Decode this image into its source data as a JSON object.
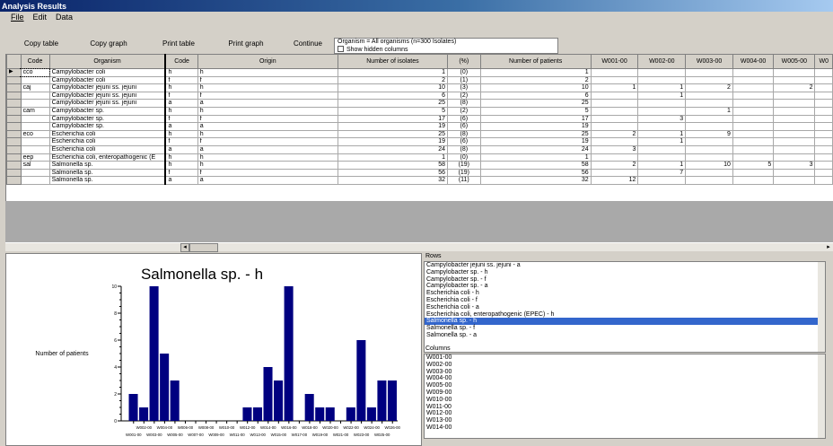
{
  "window": {
    "title": "Analysis Results"
  },
  "menu": [
    "File",
    "Edit",
    "Data"
  ],
  "toolbar": {
    "copy_table": "Copy table",
    "copy_graph": "Copy graph",
    "print_table": "Print table",
    "print_graph": "Print graph",
    "continue": "Continue",
    "organism_info": "Organism = All organisms  (n=300 Isolates)",
    "show_hidden": "Show hidden columns"
  },
  "grid": {
    "columns": [
      "Code",
      "Organism",
      "Code",
      "Origin",
      "Number of isolates",
      "(%)",
      "Number of patients",
      "W001-00",
      "W002-00",
      "W003-00",
      "W004-00",
      "W005-00",
      "W0"
    ],
    "rows": [
      [
        "cco",
        "Campylobacter coli",
        "h",
        "h",
        "1",
        "(0)",
        "1",
        "",
        "",
        "",
        "",
        "",
        ""
      ],
      [
        "",
        "Campylobacter coli",
        "f",
        "f",
        "2",
        "(1)",
        "2",
        "",
        "",
        "",
        "",
        "",
        ""
      ],
      [
        "caj",
        "Campylobacter jejuni ss. jejuni",
        "h",
        "h",
        "10",
        "(3)",
        "10",
        "1",
        "1",
        "2",
        "",
        "2",
        ""
      ],
      [
        "",
        "Campylobacter jejuni ss. jejuni",
        "f",
        "f",
        "6",
        "(2)",
        "6",
        "",
        "1",
        "",
        "",
        "",
        ""
      ],
      [
        "",
        "Campylobacter jejuni ss. jejuni",
        "a",
        "a",
        "25",
        "(8)",
        "25",
        "",
        "",
        "",
        "",
        "",
        ""
      ],
      [
        "cam",
        "Campylobacter sp.",
        "h",
        "h",
        "5",
        "(2)",
        "5",
        "",
        "",
        "1",
        "",
        "",
        ""
      ],
      [
        "",
        "Campylobacter sp.",
        "f",
        "f",
        "17",
        "(6)",
        "17",
        "",
        "3",
        "",
        "",
        "",
        ""
      ],
      [
        "",
        "Campylobacter sp.",
        "a",
        "a",
        "19",
        "(6)",
        "19",
        "",
        "",
        "",
        "",
        "",
        ""
      ],
      [
        "eco",
        "Escherichia coli",
        "h",
        "h",
        "25",
        "(8)",
        "25",
        "2",
        "1",
        "9",
        "",
        "",
        ""
      ],
      [
        "",
        "Escherichia coli",
        "f",
        "f",
        "19",
        "(6)",
        "19",
        "",
        "1",
        "",
        "",
        "",
        ""
      ],
      [
        "",
        "Escherichia coli",
        "a",
        "a",
        "24",
        "(8)",
        "24",
        "3",
        "",
        "",
        "",
        "",
        ""
      ],
      [
        "eep",
        "Escherichia coli, enteropathogenic (E",
        "h",
        "h",
        "1",
        "(0)",
        "1",
        "",
        "",
        "",
        "",
        "",
        ""
      ],
      [
        "sal",
        "Salmonella sp.",
        "h",
        "h",
        "58",
        "(19)",
        "58",
        "2",
        "1",
        "10",
        "5",
        "3",
        ""
      ],
      [
        "",
        "Salmonella sp.",
        "f",
        "f",
        "56",
        "(19)",
        "56",
        "",
        "7",
        "",
        "",
        "",
        ""
      ],
      [
        "",
        "Salmonella sp.",
        "a",
        "a",
        "32",
        "(11)",
        "32",
        "12",
        "",
        "",
        "",
        "",
        ""
      ]
    ]
  },
  "chart_data": {
    "type": "bar",
    "title": "Salmonella sp. - h",
    "ylabel": "Number of patients",
    "xlabel": "",
    "ylim": [
      0,
      10
    ],
    "yticks": [
      0,
      2,
      4,
      6,
      8,
      10
    ],
    "categories": [
      "W001-00",
      "W002-00",
      "W003-00",
      "W004-00",
      "W005-00",
      "W006-00",
      "W007-00",
      "W008-00",
      "W009-00",
      "W010-00",
      "W011-00",
      "W012-00",
      "W013-00",
      "W014-00",
      "W015-00",
      "W016-00",
      "W017-00",
      "W018-00",
      "W019-00",
      "W020-00",
      "W021-00",
      "W022-00",
      "W023-00",
      "W024-00",
      "W025-00",
      "W026-00"
    ],
    "values": [
      2,
      1,
      10,
      5,
      3,
      0,
      0,
      0,
      0,
      0,
      0,
      1,
      1,
      4,
      3,
      10,
      0,
      2,
      1,
      1,
      0,
      1,
      6,
      1,
      3,
      3
    ],
    "color": "#000080"
  },
  "panels": {
    "rows_label": "Rows",
    "columns_label": "Columns",
    "rows": [
      "Campylobacter jejuni ss. jejuni - a",
      "Campylobacter sp. - h",
      "Campylobacter sp. - f",
      "Campylobacter sp. - a",
      "Escherichia coli - h",
      "Escherichia coli - f",
      "Escherichia coli - a",
      "Escherichia coli, enteropathogenic (EPEC) - h",
      "Salmonella sp. - h",
      "Salmonella sp. - f",
      "Salmonella sp. - a"
    ],
    "selected_row": "Salmonella sp. - h",
    "columns": [
      "W001-00",
      "W002-00",
      "W003-00",
      "W004-00",
      "W005-00",
      "W009-00",
      "W010-00",
      "W011-00",
      "W012-00",
      "W013-00",
      "W014-00"
    ]
  }
}
